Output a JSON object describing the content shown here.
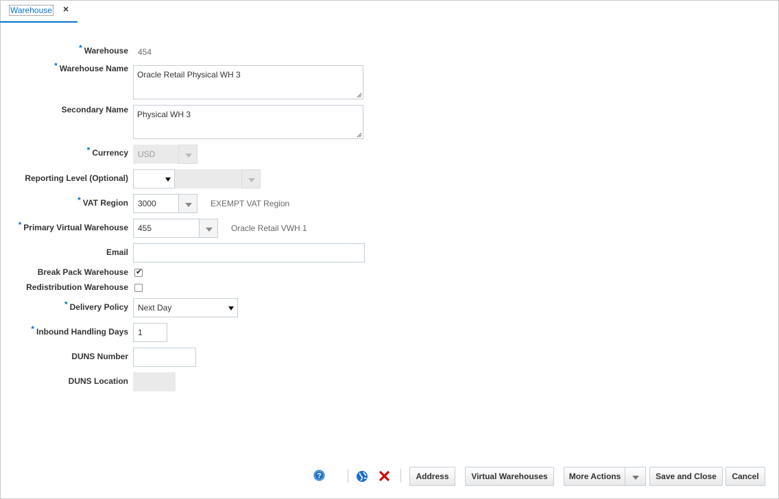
{
  "tab": {
    "label": "Warehouse",
    "close_glyph": "×"
  },
  "form": {
    "warehouse": {
      "label": "Warehouse",
      "value": "454",
      "required": "*"
    },
    "warehouse_name": {
      "label": "Warehouse Name",
      "value": "Oracle Retail Physical WH 3",
      "required": "*"
    },
    "secondary_name": {
      "label": "Secondary Name",
      "value": "Physical WH 3"
    },
    "currency": {
      "label": "Currency",
      "value": "USD",
      "required": "*"
    },
    "reporting_level": {
      "label": "Reporting Level (Optional)",
      "value": "",
      "value2": ""
    },
    "vat_region": {
      "label": "VAT Region",
      "value": "3000",
      "description": "EXEMPT VAT Region",
      "required": "*"
    },
    "primary_virtual_warehouse": {
      "label": "Primary Virtual Warehouse",
      "value": "455",
      "description": "Oracle Retail VWH 1",
      "required": "*"
    },
    "email": {
      "label": "Email",
      "value": ""
    },
    "break_pack": {
      "label": "Break Pack Warehouse",
      "checked": true
    },
    "redistribution": {
      "label": "Redistribution Warehouse",
      "checked": false
    },
    "delivery_policy": {
      "label": "Delivery Policy",
      "value": "Next Day",
      "required": "*"
    },
    "inbound_handling_days": {
      "label": "Inbound Handling Days",
      "value": "1",
      "required": "*"
    },
    "duns_number": {
      "label": "DUNS Number",
      "value": ""
    },
    "duns_location": {
      "label": "DUNS Location",
      "value": ""
    }
  },
  "toolbar": {
    "address_label": "Address",
    "virtual_warehouses_label": "Virtual Warehouses",
    "more_actions_label": "More Actions",
    "save_close_label": "Save and Close",
    "cancel_label": "Cancel"
  },
  "icons": {
    "help": "help-icon",
    "translate": "globe-icon",
    "delete": "delete-icon"
  },
  "colors": {
    "accent": "#0572ce",
    "required": "#0572ce",
    "delete": "#d40000"
  }
}
